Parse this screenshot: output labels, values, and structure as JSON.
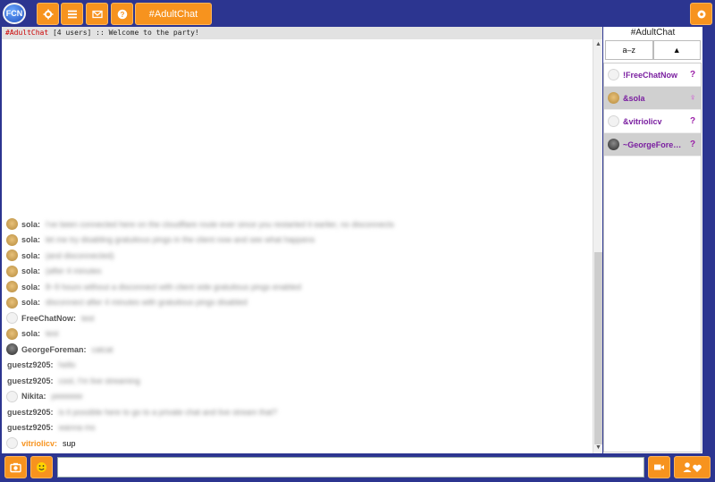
{
  "app": {
    "logo_text": "FCN"
  },
  "toolbar": {
    "icons": [
      "gear-icon",
      "list-icon",
      "mail-icon",
      "help-icon"
    ],
    "active_tab": "#AdultChat",
    "right_icon": "settings-icon"
  },
  "topic": {
    "channel": "#AdultChat",
    "rest": " [4 users] :: Welcome to the party!"
  },
  "messages": [
    {
      "nick": "sola:",
      "text": "i've been connected here on the cloudflare route ever since you restarted it earlier, no disconnects",
      "avatar": "doge"
    },
    {
      "nick": "sola:",
      "text": "let me try disabling gratuitous pings in the client now and see what happens",
      "avatar": "doge"
    },
    {
      "nick": "sola:",
      "text": "(and disconnected)",
      "avatar": "doge"
    },
    {
      "nick": "sola:",
      "text": "(after 4 minutes",
      "avatar": "doge"
    },
    {
      "nick": "sola:",
      "text": "8~9 hours without a disconnect with client side gratuitous pings enabled",
      "avatar": "doge"
    },
    {
      "nick": "sola:",
      "text": "disconnect after 4 minutes with gratuitous pings disabled",
      "avatar": "doge"
    },
    {
      "nick": "FreeChatNow:",
      "text": "test",
      "avatar": "blank"
    },
    {
      "nick": "sola:",
      "text": "test",
      "avatar": "doge"
    },
    {
      "nick": "GeorgeForeman:",
      "text": "catcat",
      "avatar": "george"
    },
    {
      "nick": "guestz9205:",
      "text": "hello",
      "avatar": "none"
    },
    {
      "nick": "guestz9205:",
      "text": "cool, I'm live streaming",
      "avatar": "none"
    },
    {
      "nick": "Nikita:",
      "text": "peeeeee",
      "avatar": "blank"
    },
    {
      "nick": "guestz9205:",
      "text": "is it possible here to go to a private chat and live stream that?",
      "avatar": "none"
    },
    {
      "nick": "guestz9205:",
      "text": "wanna ms",
      "avatar": "none"
    },
    {
      "nick": "vitriolicv:",
      "text": "sup",
      "avatar": "blank",
      "highlight": true
    }
  ],
  "userlist": {
    "channel": "#AdultChat",
    "sort_label": "a–z",
    "sort_dir": "▲",
    "users": [
      {
        "name": "!FreeChatNow",
        "gender": "?",
        "avatar": "blank",
        "selected": false
      },
      {
        "name": "&sola",
        "gender": "♀",
        "avatar": "doge",
        "selected": true
      },
      {
        "name": "&vitriolicv",
        "gender": "?",
        "avatar": "blank",
        "selected": false
      },
      {
        "name": "~GeorgeForeman",
        "gender": "?",
        "avatar": "george",
        "selected": true
      }
    ]
  },
  "bottom": {
    "left_icons": [
      "camera-icon",
      "emoji-icon"
    ],
    "input_placeholder": "",
    "right_icons": [
      "video-icon",
      "user-heart-icon"
    ]
  },
  "colors": {
    "primary": "#2c3590",
    "accent": "#f7931e",
    "nick_highlight": "#f7931e"
  }
}
